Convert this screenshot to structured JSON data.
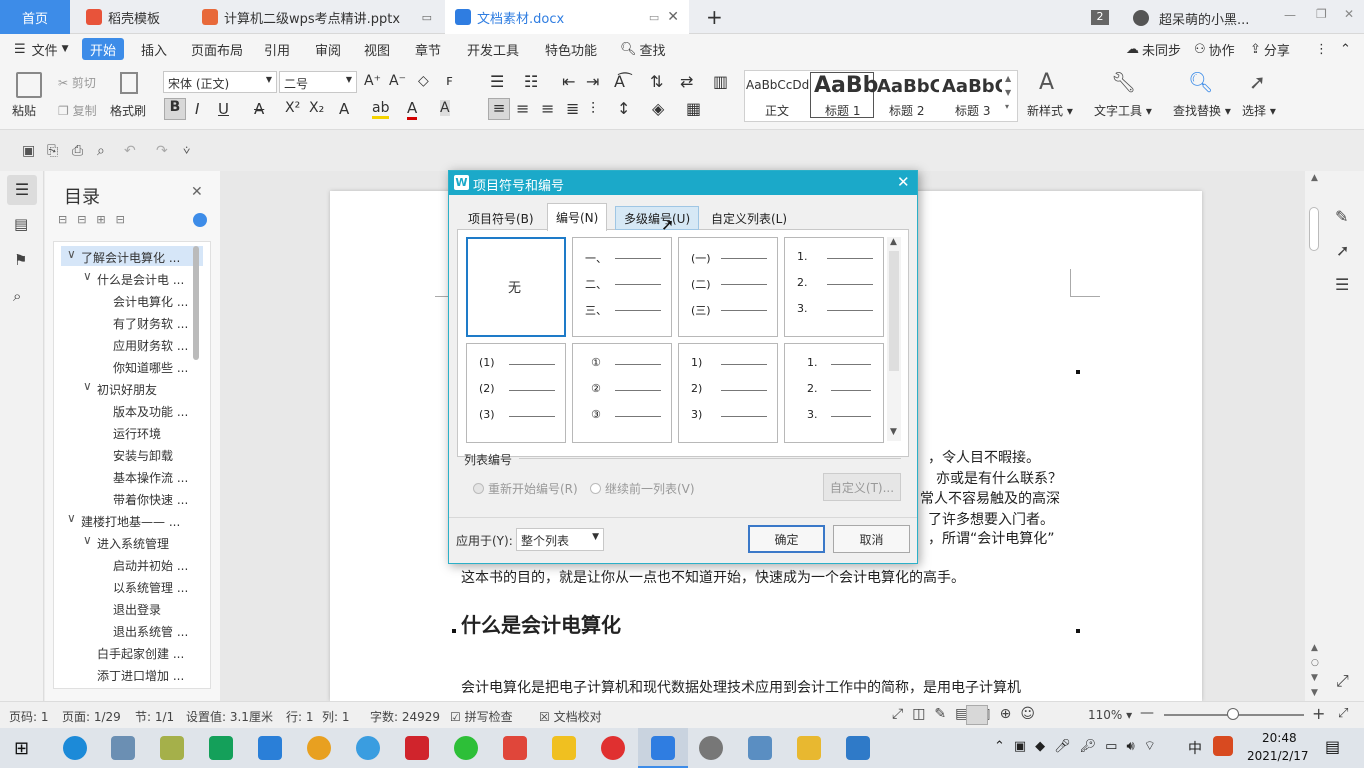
{
  "tabs": {
    "home": "首页",
    "t1": "稻壳模板",
    "t2": "计算机二级wps考点精讲.pptx",
    "t3": "文档素材.docx",
    "new_tab": "+",
    "badge": "2",
    "user": "超呆萌的小黑..."
  },
  "menu": {
    "file": "文件",
    "items": [
      "开始",
      "插入",
      "页面布局",
      "引用",
      "审阅",
      "视图",
      "章节",
      "开发工具",
      "特色功能"
    ],
    "search": "查找",
    "sync": "未同步",
    "collab": "协作",
    "share": "分享"
  },
  "ribbon": {
    "paste": "粘贴",
    "cut": "剪切",
    "copy": "复制",
    "format_painter": "格式刷",
    "font_name": "宋体 (正文)",
    "font_size": "二号",
    "styles": [
      {
        "preview": "AaBbCcDd",
        "label": "正文"
      },
      {
        "preview": "AaBb",
        "label": "标题 1"
      },
      {
        "preview": "AaBbC",
        "label": "标题 2"
      },
      {
        "preview": "AaBbC",
        "label": "标题 3"
      }
    ],
    "new_style": "新样式",
    "text_tools": "文字工具",
    "find_replace": "查找替换",
    "select": "选择"
  },
  "toc": {
    "title": "目录",
    "items": [
      "了解会计电算化 ...",
      "什么是会计电 ...",
      "会计电算化 ...",
      "有了财务软 ...",
      "应用财务软 ...",
      "你知道哪些 ...",
      "初识好朋友",
      "版本及功能 ...",
      "运行环境",
      "安装与卸载",
      "基本操作流 ...",
      "带着你快速 ...",
      "建楼打地基—— ...",
      "进入系统管理",
      "启动并初始 ...",
      "以系统管理 ...",
      "退出登录",
      "退出系统管 ...",
      "白手起家创建 ...",
      "添丁进口增加 ..."
    ]
  },
  "document": {
    "line1": "，令人目不暇接。",
    "line2": "亦或是有什么联系？",
    "line3": "常人不容易触及的高深",
    "line4": "了许多想要入门者。",
    "line5": "，所谓“会计电算化”",
    "line6": "这本书的目的，就是让你从一点也不知道开始，快速成为一个会计电算化的高手。",
    "heading": "什么是会计电算化",
    "line7": "会计电算化是把电子计算机和现代数据处理技术应用到会计工作中的简称，是用电子计算机"
  },
  "dialog": {
    "title": "项目符号和编号",
    "tabs": [
      "项目符号(B)",
      "编号(N)",
      "多级编号(U)",
      "自定义列表(L)"
    ],
    "none_label": "无",
    "cells": [
      [
        "一、",
        "二、",
        "三、"
      ],
      [
        "(一)",
        "(二)",
        "(三)"
      ],
      [
        "1.",
        "2.",
        "3."
      ],
      [
        "(1)",
        "(2)",
        "(3)"
      ],
      [
        "①",
        "②",
        "③"
      ],
      [
        "1)",
        "2)",
        "3)"
      ],
      [
        "1.",
        "2.",
        "3."
      ]
    ],
    "list_numbering": "列表编号",
    "restart": "重新开始编号(R)",
    "continue": "继续前一列表(V)",
    "customize": "自定义(T)...",
    "apply_to_label": "应用于(Y):",
    "apply_to_value": "整个列表",
    "ok": "确定",
    "cancel": "取消"
  },
  "status": {
    "page_num": "页码: 1",
    "page": "页面: 1/29",
    "section": "节: 1/1",
    "setting": "设置值: 3.1厘米",
    "line": "行: 1",
    "column": "列: 1",
    "word_count": "字数: 24929",
    "spell": "拼写检查",
    "proof": "文档校对",
    "zoom": "110%"
  },
  "taskbar": {
    "time": "20:48",
    "date": "2021/2/17",
    "ime": "中"
  }
}
